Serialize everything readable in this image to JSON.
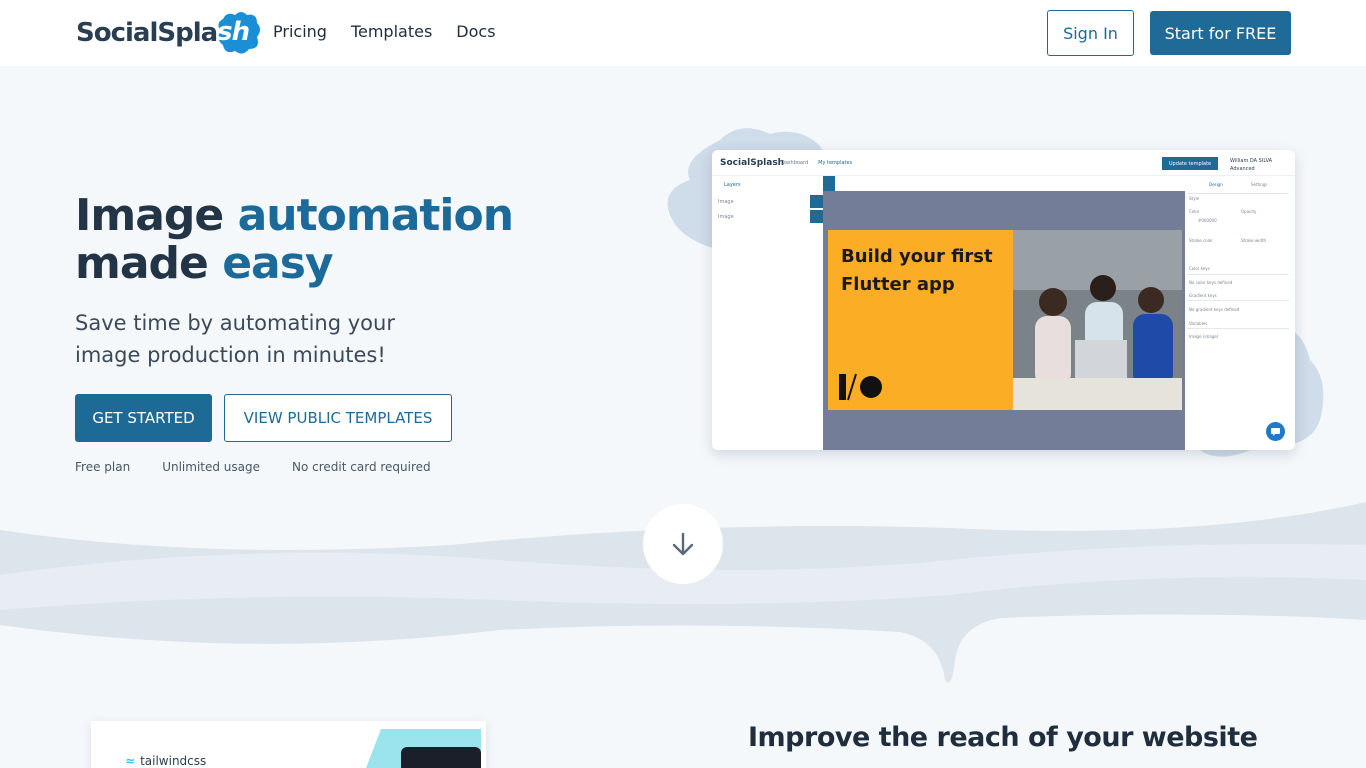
{
  "header": {
    "logo_text": "SocialSpla",
    "logo_accent": "sh",
    "nav": [
      {
        "label": "Pricing"
      },
      {
        "label": "Templates"
      },
      {
        "label": "Docs"
      }
    ],
    "sign_in": "Sign In",
    "start_free": "Start for FREE"
  },
  "hero": {
    "title_part1": "Image ",
    "title_accent1": "automation",
    "title_part2": "made ",
    "title_accent2": "easy",
    "subtitle": "Save time by automating your image production in minutes!",
    "get_started": "GET STARTED",
    "view_templates": "VIEW PUBLIC TEMPLATES",
    "perks": [
      "Free plan",
      "Unlimited usage",
      "No credit card required"
    ]
  },
  "app_preview": {
    "logo": "SocialSplash",
    "nav_dashboard": "Dashboard",
    "nav_templates": "My templates",
    "update_button": "Update template",
    "user_name": "William DA SILVA",
    "user_plan": "Advanced",
    "left_tab": "Layers",
    "layers": [
      "Image",
      "Image"
    ],
    "right_tabs": [
      "Design",
      "Settings"
    ],
    "right_labels": [
      "Style",
      "Color",
      "Opacity",
      "Stroke color",
      "Stroke width",
      "Color keys",
      "No color keys defined",
      "Gradient keys",
      "No gradient keys defined",
      "Variables",
      "Image (image)"
    ],
    "color_value": "#000000",
    "poster_title": "Build your first Flutter app"
  },
  "section2": {
    "card_logo": "tailwindcss",
    "heading": "Improve the reach of your website"
  },
  "colors": {
    "brand": "#1f6a97",
    "accent_text": "#1c6a99",
    "poster": "#fbad26",
    "canvas": "#737d97",
    "wave": "#dce4ec"
  },
  "icons": {
    "scroll_down": "arrow-down-icon",
    "chat": "chat-icon"
  }
}
